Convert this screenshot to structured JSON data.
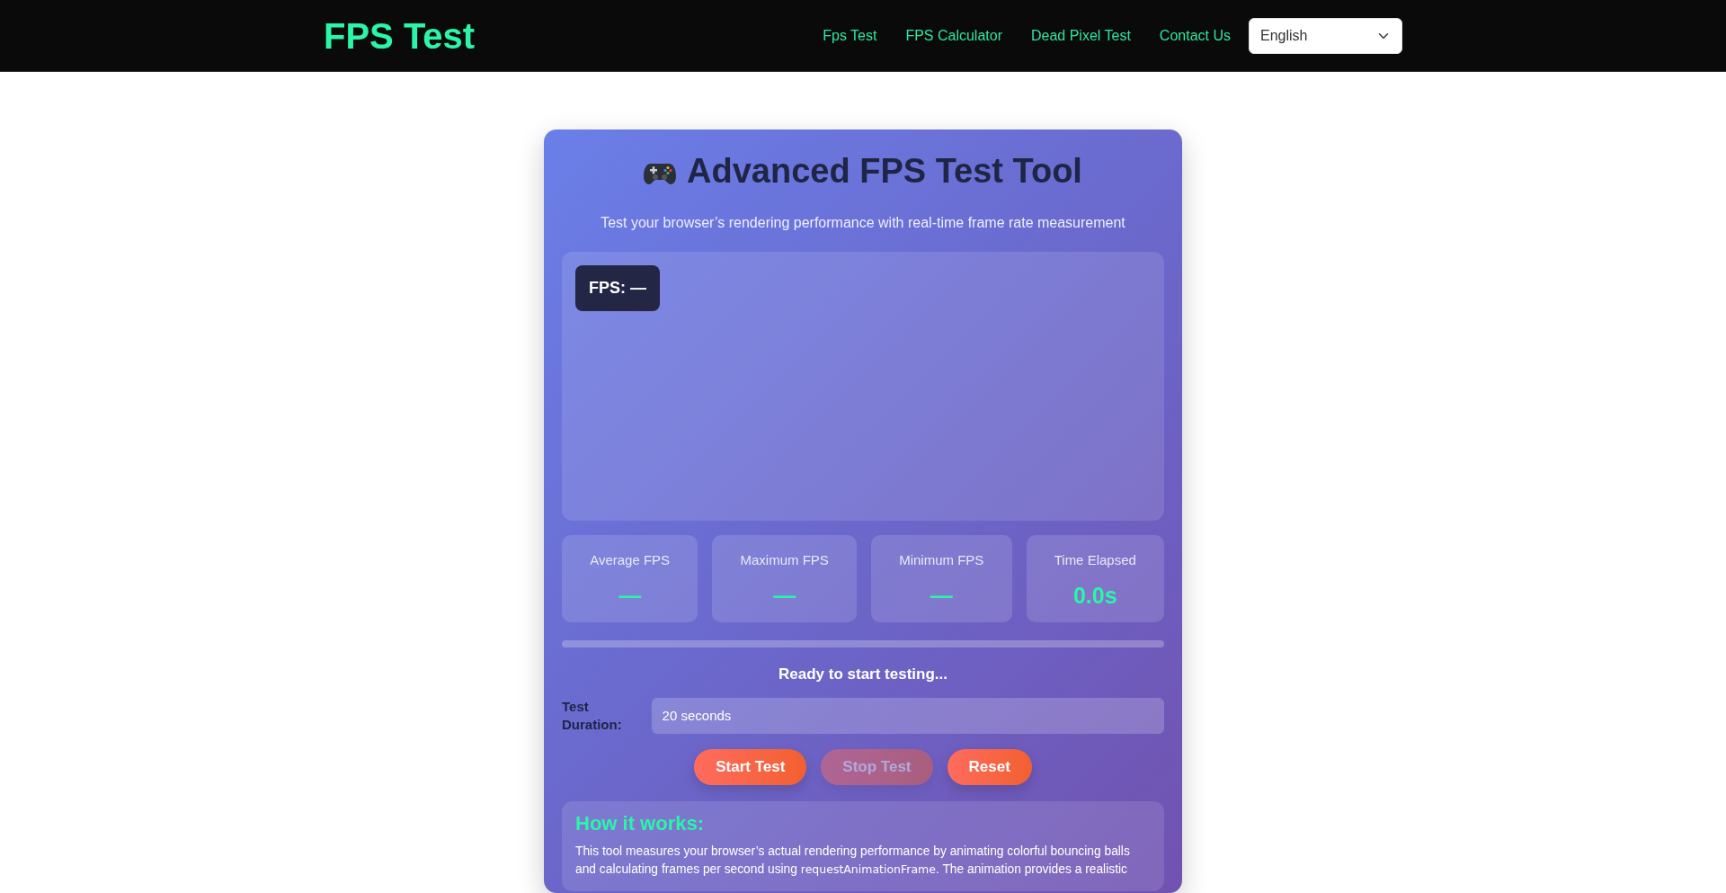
{
  "navbar": {
    "brand": "FPS Test",
    "links": [
      {
        "label": "Fps Test"
      },
      {
        "label": "FPS Calculator"
      },
      {
        "label": "Dead Pixel Test"
      },
      {
        "label": "Contact Us"
      }
    ],
    "language": {
      "value": "English"
    }
  },
  "tool": {
    "title": "Advanced FPS Test Tool",
    "subtitle": "Test your browser’s rendering performance with real-time frame rate measurement",
    "fps_overlay": "FPS: —",
    "stats": [
      {
        "label": "Average FPS",
        "value": "—"
      },
      {
        "label": "Maximum FPS",
        "value": "—"
      },
      {
        "label": "Minimum FPS",
        "value": "—"
      },
      {
        "label": "Time Elapsed",
        "value": "0.0s"
      }
    ],
    "status": "Ready to start testing...",
    "duration": {
      "label": "Test Duration:",
      "value": "20 seconds"
    },
    "buttons": [
      {
        "label": "Start Test",
        "disabled": false
      },
      {
        "label": "Stop Test",
        "disabled": true
      },
      {
        "label": "Reset",
        "disabled": false
      }
    ],
    "info": {
      "heading": "How it works:",
      "parts": [
        {
          "kind": "text",
          "text": "This tool measures your browser’s actual rendering performance by animating colorful bouncing balls and calculating frames per second using "
        },
        {
          "kind": "code",
          "text": "requestAnimationFrame"
        },
        {
          "kind": "text",
          "text": ". The animation provides a realistic"
        }
      ]
    }
  }
}
